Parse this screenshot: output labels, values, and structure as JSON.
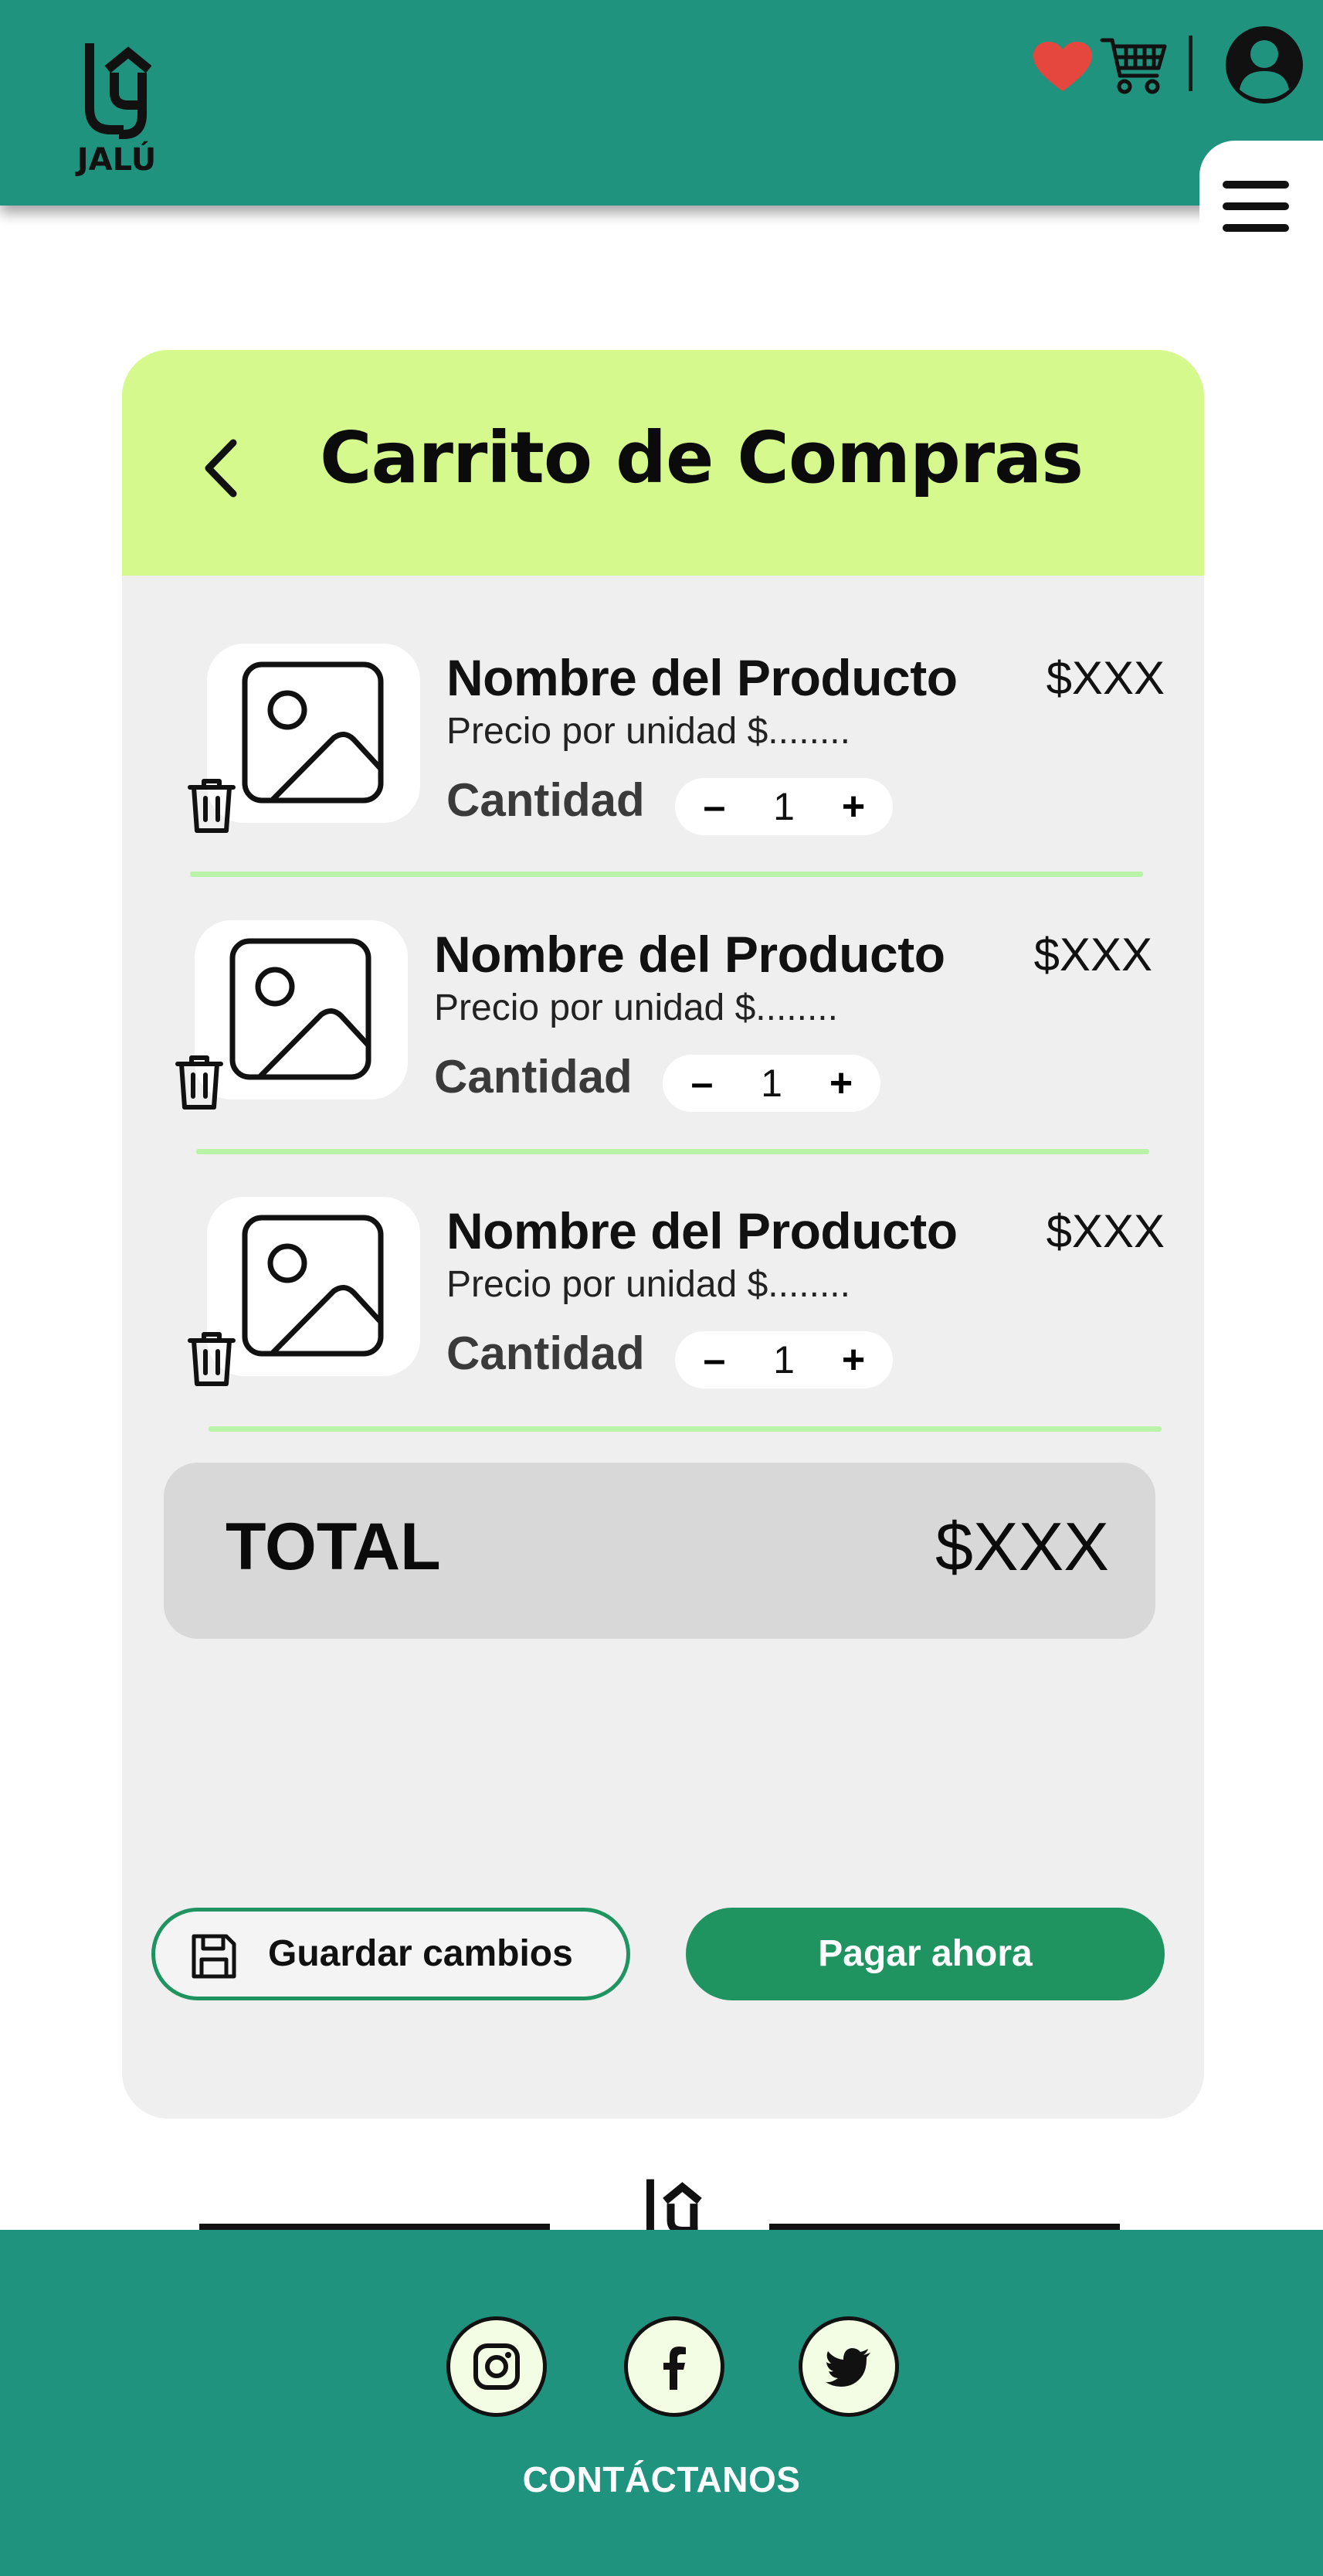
{
  "colors": {
    "brand": "#20937f",
    "brand_dark": "#1f9460",
    "accent_head": "#d6f98d",
    "accent_line": "#b8f3a8",
    "heart": "#e5473e",
    "social_bg": "#f3fde3"
  },
  "header": {
    "logo_text": "JALÚ",
    "icons": [
      "heart-icon",
      "cart-icon",
      "user-avatar-icon",
      "menu-icon"
    ]
  },
  "cart": {
    "title": "Carrito de Compras",
    "items": [
      {
        "name": "Nombre del Producto",
        "price": "$XXX",
        "unit_price": "Precio por unidad $........",
        "qty_label": "Cantidad",
        "qty": "1"
      },
      {
        "name": "Nombre del Producto",
        "price": "$XXX",
        "unit_price": "Precio por unidad $........",
        "qty_label": "Cantidad",
        "qty": "1"
      },
      {
        "name": "Nombre del Producto",
        "price": "$XXX",
        "unit_price": "Precio por unidad $........",
        "qty_label": "Cantidad",
        "qty": "1"
      }
    ],
    "stepper": {
      "minus": "–",
      "plus": "+"
    },
    "total_label": "TOTAL",
    "total_value": "$XXX",
    "save_label": "Guardar cambios",
    "pay_label": "Pagar ahora"
  },
  "footer": {
    "social": [
      "instagram-icon",
      "facebook-icon",
      "twitter-icon"
    ],
    "contact_label": "CONTÁCTANOS"
  }
}
